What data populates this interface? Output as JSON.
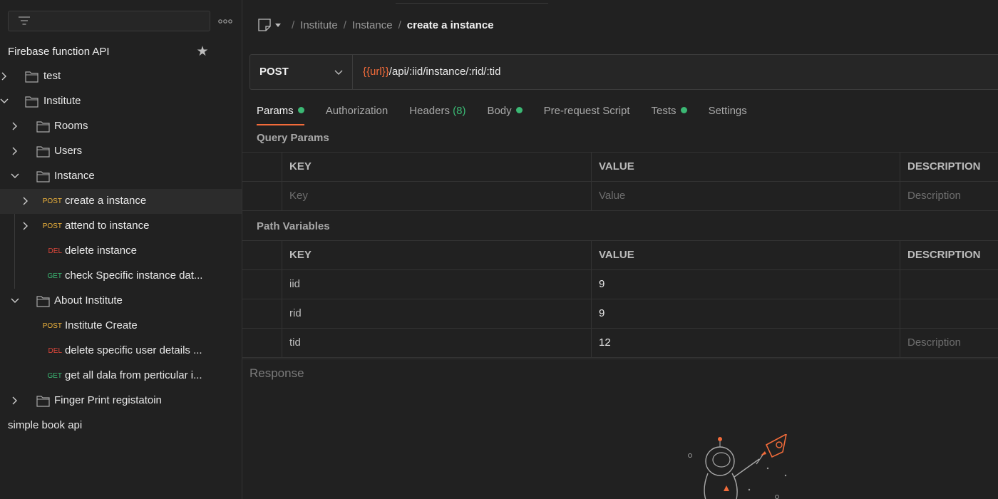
{
  "sidebar": {
    "collection_title": "Firebase function API",
    "tree": [
      {
        "type": "folder",
        "label": "test",
        "expanded": false
      },
      {
        "type": "folder",
        "label": "Institute",
        "expanded": true
      },
      {
        "type": "folder",
        "label": "Rooms",
        "expanded": false
      },
      {
        "type": "folder",
        "label": "Users",
        "expanded": false
      },
      {
        "type": "folder",
        "label": "Instance",
        "expanded": true
      },
      {
        "type": "request",
        "method": "POST",
        "label": "create a instance",
        "selected": true
      },
      {
        "type": "request",
        "method": "POST",
        "label": "attend to instance"
      },
      {
        "type": "request",
        "method": "DEL",
        "label": "delete instance"
      },
      {
        "type": "request",
        "method": "GET",
        "label": "check Specific instance dat..."
      },
      {
        "type": "folder",
        "label": "About Institute",
        "expanded": true
      },
      {
        "type": "request",
        "method": "POST",
        "label": "Institute Create"
      },
      {
        "type": "request",
        "method": "DEL",
        "label": "delete specific user details ..."
      },
      {
        "type": "request",
        "method": "GET",
        "label": "get all dala from perticular i..."
      },
      {
        "type": "folder",
        "label": "Finger Print registatoin",
        "expanded": false
      }
    ],
    "second_collection": "simple book api"
  },
  "breadcrumb": {
    "parts": [
      "Institute",
      "Instance"
    ],
    "current": "create a instance",
    "separator": "/"
  },
  "request": {
    "method": "POST",
    "url_var": "{{url}}",
    "url_path": "/api/:iid/instance/:rid/:tid"
  },
  "tabs": [
    {
      "label": "Params",
      "dot": true,
      "active": true
    },
    {
      "label": "Authorization"
    },
    {
      "label": "Headers",
      "count": "(8)"
    },
    {
      "label": "Body",
      "dot": true
    },
    {
      "label": "Pre-request Script"
    },
    {
      "label": "Tests",
      "dot": true
    },
    {
      "label": "Settings"
    }
  ],
  "query_params": {
    "title": "Query Params",
    "headers": {
      "key": "KEY",
      "value": "VALUE",
      "description": "DESCRIPTION"
    },
    "placeholders": {
      "key": "Key",
      "value": "Value",
      "description": "Description"
    }
  },
  "path_variables": {
    "title": "Path Variables",
    "headers": {
      "key": "KEY",
      "value": "VALUE",
      "description": "DESCRIPTION"
    },
    "rows": [
      {
        "key": "iid",
        "value": "9",
        "description": ""
      },
      {
        "key": "rid",
        "value": "9",
        "description": ""
      },
      {
        "key": "tid",
        "value": "12",
        "description": "Description"
      }
    ]
  },
  "response": {
    "title": "Response"
  },
  "colors": {
    "accent": "#f26b3a",
    "post": "#f0b43c",
    "del": "#e0473a",
    "get": "#3bb874"
  }
}
